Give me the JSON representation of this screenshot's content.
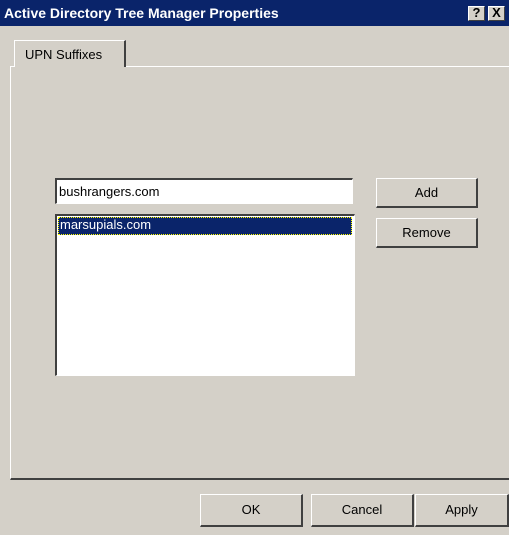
{
  "window": {
    "title": "Active Directory Tree Manager Properties",
    "help_button": "?",
    "close_button": "X",
    "title_color": "#0a246a"
  },
  "tabs": [
    {
      "label": "UPN Suffixes",
      "selected": true
    }
  ],
  "upn": {
    "input_value": "bushrangers.com",
    "add_label": "Add",
    "remove_label": "Remove",
    "list_items": [
      {
        "label": "marsupials.com",
        "selected": true
      }
    ]
  },
  "footer": {
    "ok_label": "OK",
    "cancel_label": "Cancel",
    "apply_label": "Apply"
  }
}
